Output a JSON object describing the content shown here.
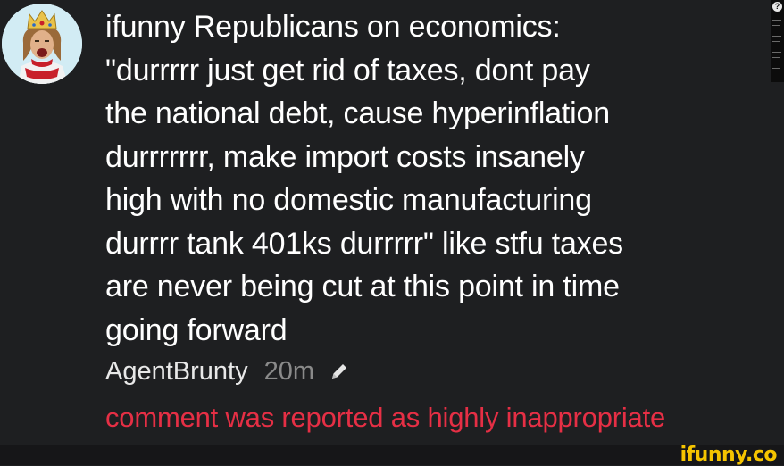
{
  "comment": {
    "text": "ifunny Republicans on economics:\n\"durrrrr just get rid of taxes, dont pay\nthe national debt, cause hyperinflation\ndurrrrrrr, make import costs insanely\nhigh with no domestic manufacturing\ndurrrr tank 401ks durrrrr\" like stfu taxes\nare never being cut at this point in time\ngoing forward",
    "username": "AgentBrunty",
    "timestamp": "20m",
    "edit_icon": "pencil-icon",
    "reported_notice": "comment was reported as highly inappropriate"
  },
  "colors": {
    "background": "#1e1f21",
    "text": "#ffffff",
    "timestamp": "#8a8a8a",
    "reported": "#e62f45",
    "watermark": "#f5c400"
  },
  "watermark": "ifunny.co"
}
